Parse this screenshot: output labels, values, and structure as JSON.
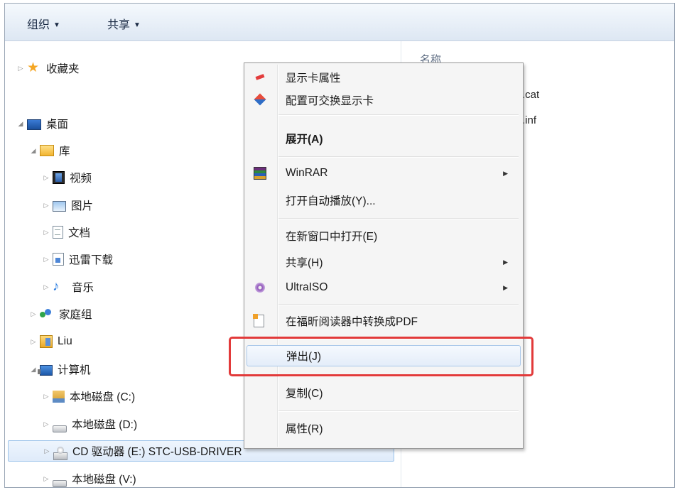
{
  "toolbar": {
    "organize": "组织",
    "share": "共享"
  },
  "content": {
    "column_header": "名称",
    "files": [
      ".cat",
      ".inf"
    ]
  },
  "tree": {
    "favorites": "收藏夹",
    "desktop": "桌面",
    "library": "库",
    "videos": "视频",
    "pictures": "图片",
    "documents": "文档",
    "thunder_downloads": "迅雷下载",
    "music": "音乐",
    "homegroup": "家庭组",
    "user": "Liu",
    "computer": "计算机",
    "drive_c": "本地磁盘 (C:)",
    "drive_d": "本地磁盘 (D:)",
    "drive_e": "CD 驱动器 (E:) STC-USB-DRIVER",
    "drive_v": "本地磁盘 (V:)"
  },
  "menu": {
    "display_card_properties": "显示卡属性",
    "switchable_graphics": "配置可交换显示卡",
    "expand": "展开(A)",
    "winrar": "WinRAR",
    "autoplay": "打开自动播放(Y)...",
    "open_new_window": "在新窗口中打开(E)",
    "share": "共享(H)",
    "ultraiso": "UltraISO",
    "foxit_convert_pdf": "在福昕阅读器中转换成PDF",
    "eject": "弹出(J)",
    "copy": "复制(C)",
    "properties": "属性(R)"
  },
  "colors": {
    "highlight_box": "#e23a3a",
    "selection_border": "#9cc3ea",
    "toolbar_bg": "#dde7f3"
  }
}
